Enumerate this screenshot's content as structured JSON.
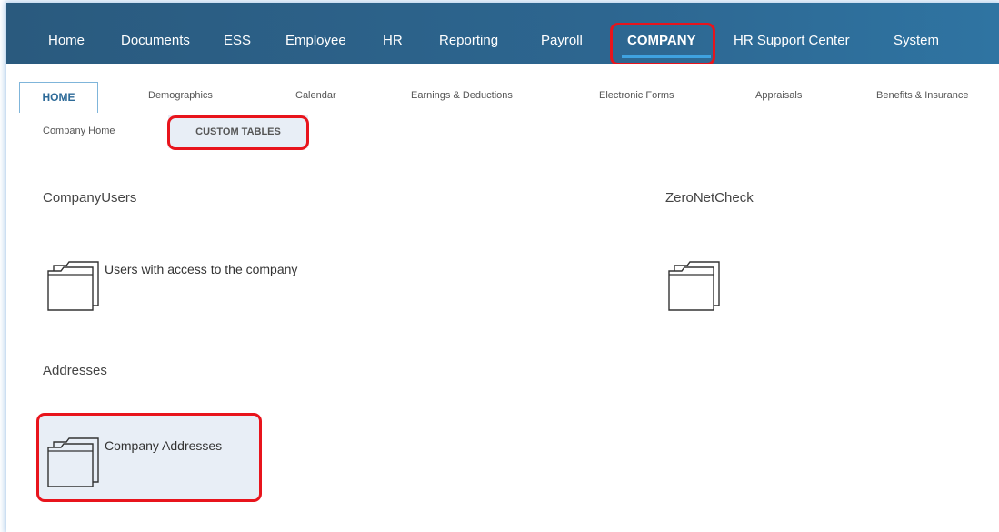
{
  "top_nav": {
    "items": [
      "Home",
      "Documents",
      "ESS",
      "Employee",
      "HR",
      "Reporting",
      "Payroll",
      "COMPANY",
      "HR Support Center",
      "System"
    ],
    "active": "COMPANY"
  },
  "sub_nav": {
    "items": [
      "HOME",
      "Demographics",
      "Calendar",
      "Earnings & Deductions",
      "Electronic Forms",
      "Appraisals",
      "Benefits & Insurance"
    ],
    "active": "HOME"
  },
  "third_nav": {
    "items": [
      "Company Home",
      "CUSTOM TABLES"
    ],
    "active": "CUSTOM TABLES"
  },
  "sections": [
    {
      "title": "CompanyUsers",
      "item_label": "Users with access to the company",
      "icon": "folder-icon"
    },
    {
      "title": "ZeroNetCheck",
      "item_label": "",
      "icon": "folder-icon"
    },
    {
      "title": "Addresses",
      "item_label": "Company Addresses",
      "icon": "folder-icon"
    }
  ],
  "colors": {
    "topnav_bg": "#2d6690",
    "accent": "#3fa2e0",
    "highlight_border": "#e8141c",
    "selected_bg": "#e8eef6"
  }
}
